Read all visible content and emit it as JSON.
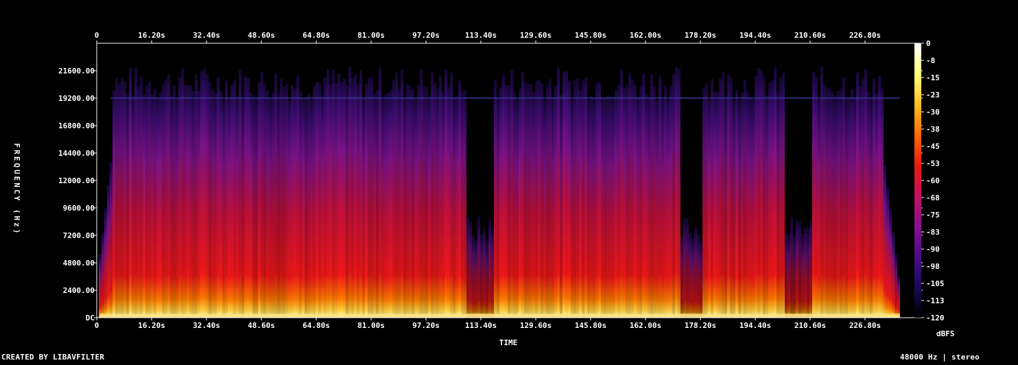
{
  "footer": {
    "credit": "CREATED BY LIBAVFILTER",
    "format": "48000 Hz | stereo"
  },
  "chart_data": {
    "type": "heatmap",
    "title": "",
    "xlabel": "TIME",
    "ylabel": "FREQUENCY (Hz)",
    "colorbar_label": "dBFS",
    "x_ticks": [
      "0",
      "16.20s",
      "32.40s",
      "48.60s",
      "64.80s",
      "81.00s",
      "97.20s",
      "113.40s",
      "129.60s",
      "145.80s",
      "162.00s",
      "178.20s",
      "194.40s",
      "210.60s",
      "226.80s"
    ],
    "x_tick_step_s": 16.2,
    "duration_s": 243,
    "y_ticks": [
      "DC",
      "2400.00",
      "4800.00",
      "7200.00",
      "9600.00",
      "12000.00",
      "14400.00",
      "16800.00",
      "19200.00",
      "21600.00"
    ],
    "y_tick_step_hz": 2400,
    "y_max_hz": 24000,
    "colorbar_ticks": [
      "0",
      "-8",
      "-15",
      "-23",
      "-30",
      "-38",
      "-45",
      "-53",
      "-60",
      "-68",
      "-75",
      "-83",
      "-90",
      "-98",
      "-105",
      "-113",
      "-120"
    ],
    "colorbar_range_db": [
      -120,
      0
    ],
    "colormap": [
      "#000000",
      "#1a0a5a",
      "#4a0c8c",
      "#8a1090",
      "#c41060",
      "#ec1a10",
      "#ff6a00",
      "#ffc020",
      "#ffff80",
      "#ffffff"
    ],
    "quiet_segments_s": [
      [
        109,
        117
      ],
      [
        172,
        178
      ],
      [
        203,
        211
      ]
    ],
    "grid": false
  }
}
